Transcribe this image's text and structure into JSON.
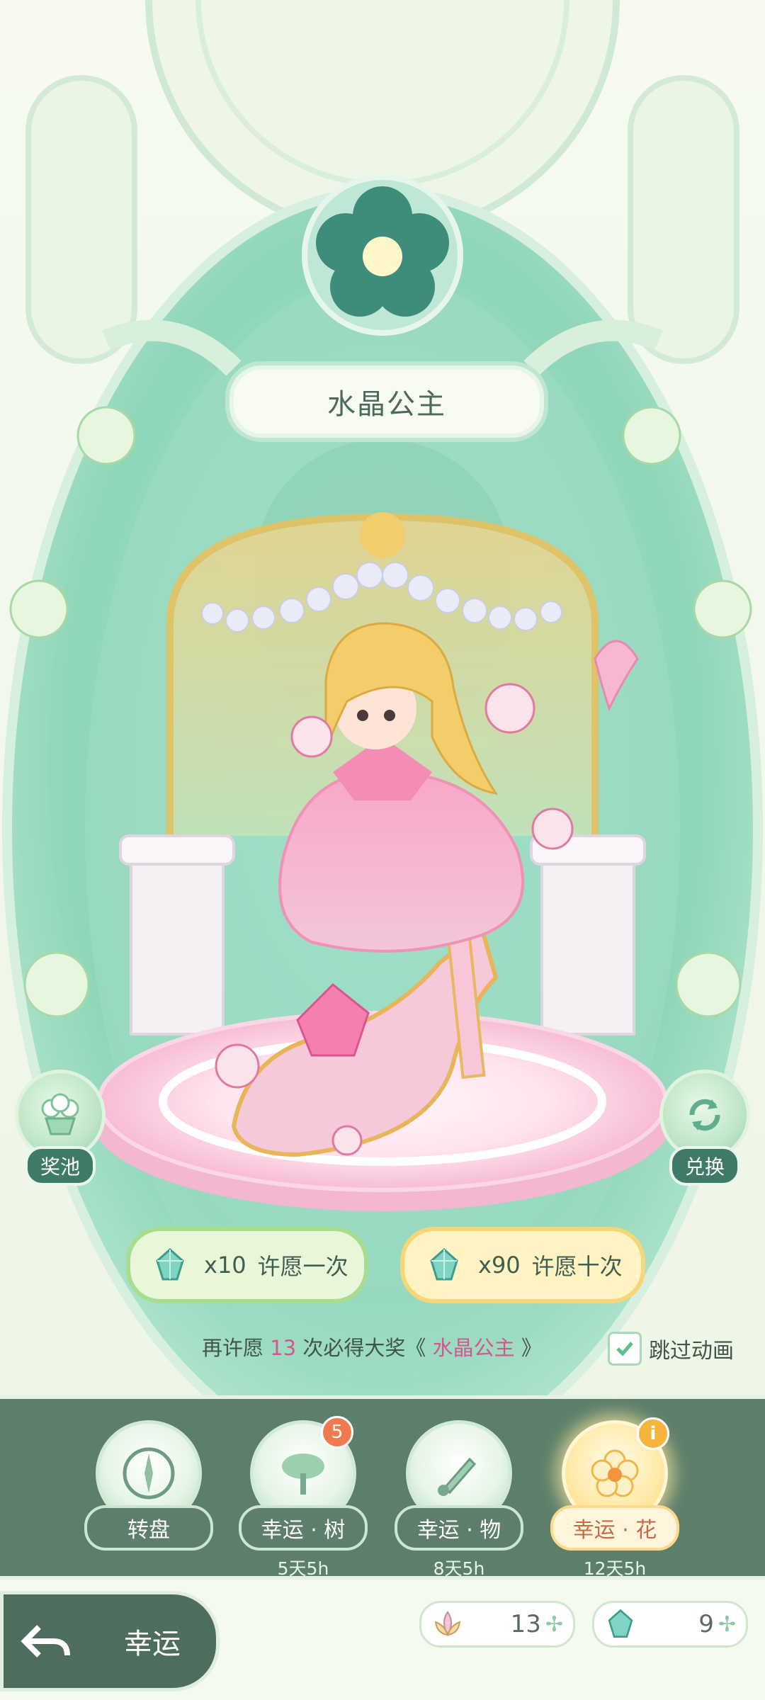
{
  "banner": {
    "title": "水晶公主"
  },
  "side": {
    "pool_label": "奖池",
    "exchange_label": "兑换"
  },
  "wish": {
    "single": {
      "cost": "x10",
      "label": "许愿一次"
    },
    "ten": {
      "cost": "x90",
      "label": "许愿十次"
    }
  },
  "guarantee": {
    "prefix": "再许愿",
    "count": "13",
    "middle": "次必得大奖《",
    "prize": "水晶公主",
    "suffix": "》"
  },
  "skip": {
    "label": "跳过动画",
    "checked": true
  },
  "tabs": [
    {
      "name": "转盘",
      "time": "",
      "icon": "compass-icon"
    },
    {
      "name": "幸运 · 树",
      "time": "5天5h",
      "badge": "5",
      "icon": "tree-icon"
    },
    {
      "name": "幸运 · 物",
      "time": "8天5h",
      "icon": "brush-icon"
    },
    {
      "name": "幸运 · 花",
      "time": "12天5h",
      "icon": "flower-icon",
      "active": true,
      "info": "i"
    }
  ],
  "nav": {
    "back_label": "幸运"
  },
  "currency": {
    "flower_amount": "13",
    "crystal_amount": "9"
  },
  "colors": {
    "mint": "#8fd6b4",
    "pink": "#f5a6c8",
    "gold": "#f2c96a",
    "tabbar": "#5d7e6a"
  }
}
